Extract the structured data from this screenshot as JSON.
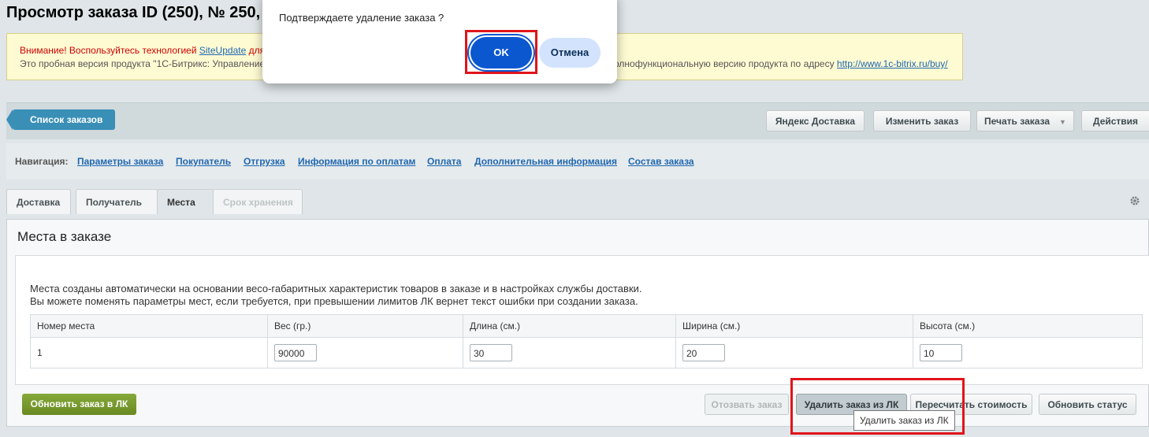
{
  "page": {
    "title": "Просмотр заказа ID (250), № 250,"
  },
  "notice": {
    "line1_prefix": "Внимание! Воспользуйтесь технологией ",
    "line1_link": "SiteUpdate",
    "line1_suffix": " для о",
    "line2": "Это пробная версия продукта \"1С-Битрикс: Управление",
    "line2b_prefix": "олнофункциональную версию продукта по адресу ",
    "line2b_link": "http://www.1c-bitrix.ru/buy/"
  },
  "toolbar": {
    "back_label": "Список заказов",
    "buttons": {
      "yandex": "Яндекс Доставка",
      "edit": "Изменить заказ",
      "print": "Печать заказа",
      "actions": "Действия"
    }
  },
  "nav": {
    "label": "Навигация:",
    "links": [
      "Параметры заказа",
      "Покупатель",
      "Отгрузка",
      "Информация по оплатам",
      "Оплата",
      "Дополнительная информация",
      "Состав заказа"
    ]
  },
  "tabs": [
    "Доставка",
    "Получатель",
    "Места",
    "Срок хранения"
  ],
  "panel": {
    "title": "Места в заказе",
    "info_line1": "Места созданы автоматически на основании весо-габаритных характеристик товаров в заказе и в настройках службы доставки.",
    "info_line2": "Вы можете поменять параметры мест, если требуется, при превышении лимитов ЛК вернет текст ошибки при создании заказа.",
    "columns": [
      "Номер места",
      "Вес (гр.)",
      "Длина (см.)",
      "Ширина (см.)",
      "Высота (см.)"
    ],
    "row": {
      "number": "1",
      "weight": "90000",
      "length": "30",
      "width": "20",
      "height": "10"
    }
  },
  "bottom": {
    "update_order": "Обновить заказ в ЛК",
    "recall": "Отозвать заказ",
    "delete": "Удалить заказ из ЛК",
    "recalc": "Пересчитать стоимость",
    "update_status": "Обновить статус"
  },
  "tooltip": "Удалить заказ из ЛК",
  "dialog": {
    "message": "Подтверждаете удаление заказа ?",
    "ok": "OK",
    "cancel": "Отмена"
  }
}
